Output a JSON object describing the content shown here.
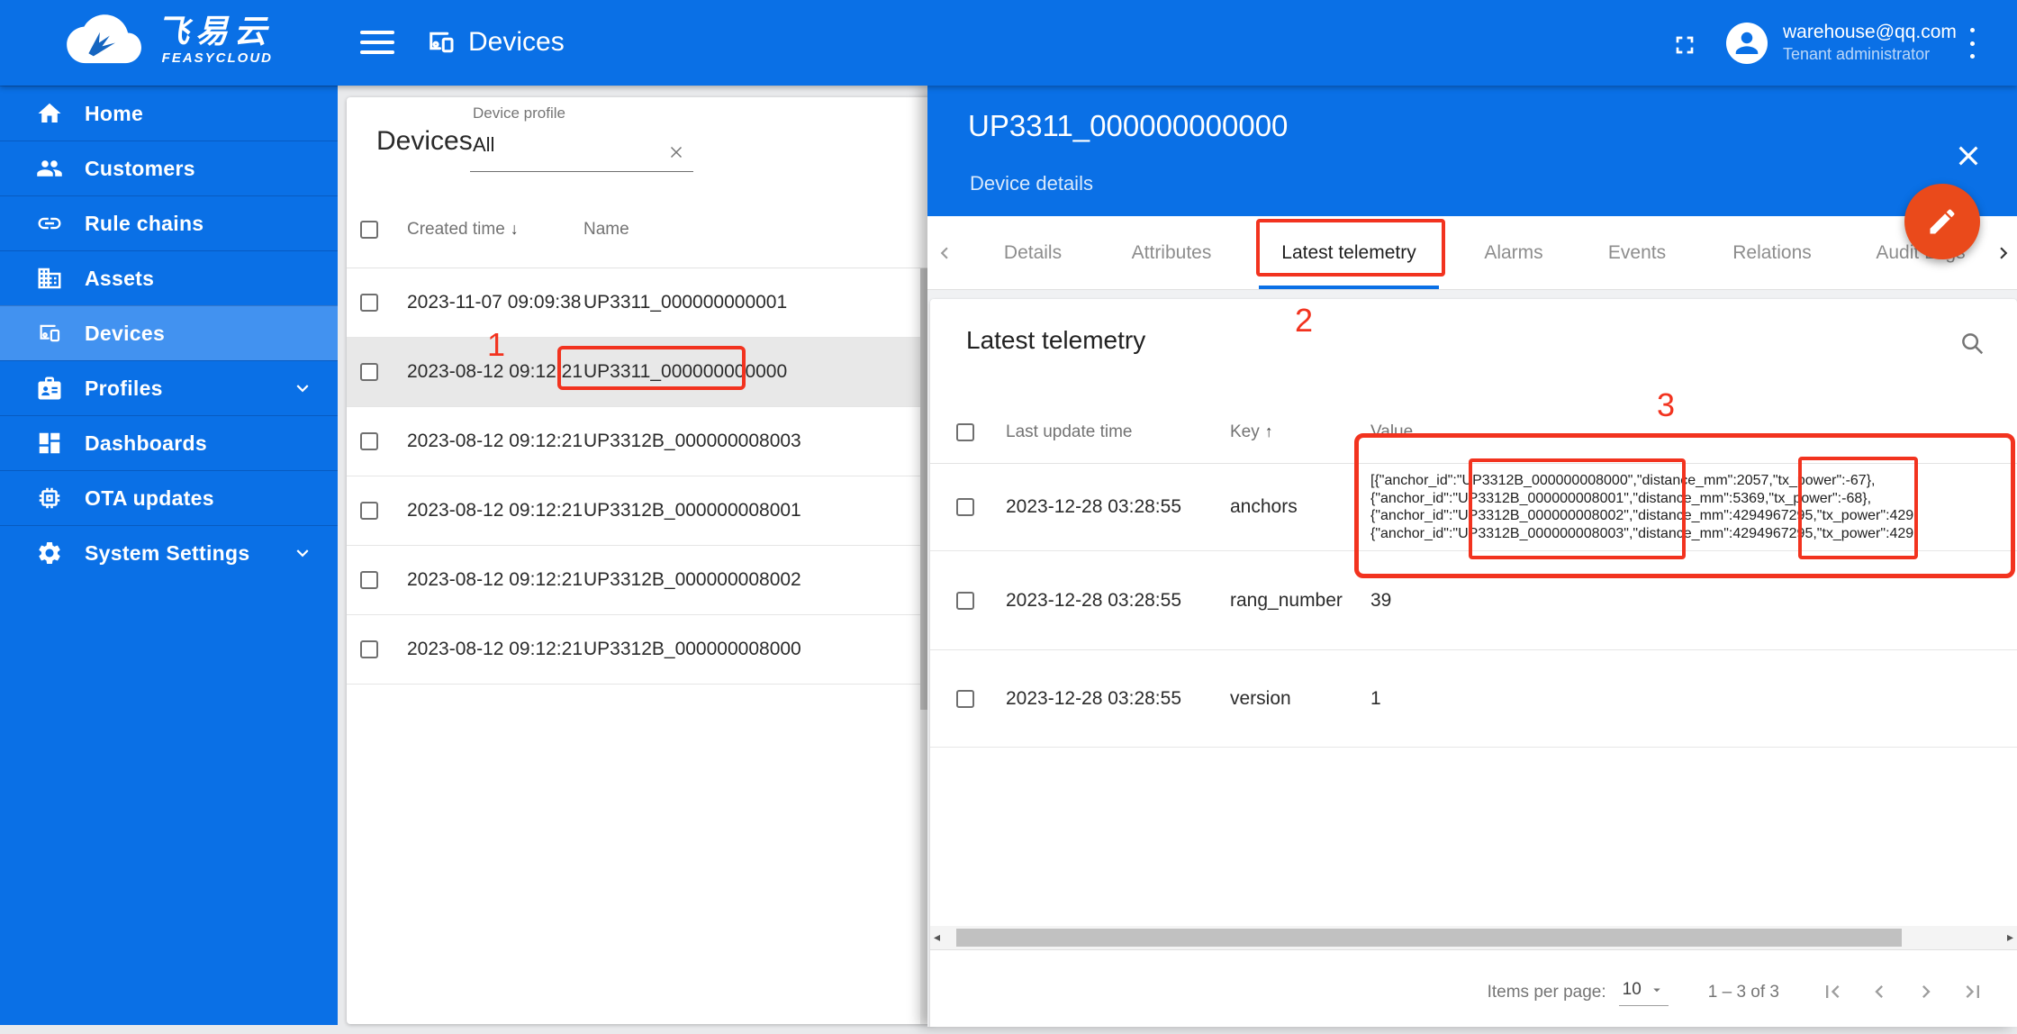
{
  "brand": {
    "name_cn": "飞易云",
    "name_en": "FEASYCLOUD"
  },
  "topbar": {
    "title": "Devices",
    "user_email": "warehouse@qq.com",
    "user_role": "Tenant administrator"
  },
  "sidebar": {
    "items": [
      {
        "label": "Home",
        "icon": "home-icon"
      },
      {
        "label": "Customers",
        "icon": "customers-icon"
      },
      {
        "label": "Rule chains",
        "icon": "rule-chains-icon"
      },
      {
        "label": "Assets",
        "icon": "assets-icon"
      },
      {
        "label": "Devices",
        "icon": "devices-icon",
        "selected": true
      },
      {
        "label": "Profiles",
        "icon": "profiles-icon",
        "expandable": true
      },
      {
        "label": "Dashboards",
        "icon": "dashboards-icon"
      },
      {
        "label": "OTA updates",
        "icon": "ota-updates-icon"
      },
      {
        "label": "System Settings",
        "icon": "system-settings-icon",
        "expandable": true
      }
    ]
  },
  "devices_panel": {
    "title": "Devices",
    "filter": {
      "label": "Device profile",
      "value": "All"
    },
    "columns": {
      "created_time": "Created time",
      "name": "Name"
    },
    "rows": [
      {
        "created_time": "2023-11-07 09:09:38",
        "name": "UP3311_000000000001"
      },
      {
        "created_time": "2023-08-12 09:12:21",
        "name": "UP3311_000000000000",
        "selected": true
      },
      {
        "created_time": "2023-08-12 09:12:21",
        "name": "UP3312B_000000008003"
      },
      {
        "created_time": "2023-08-12 09:12:21",
        "name": "UP3312B_000000008001"
      },
      {
        "created_time": "2023-08-12 09:12:21",
        "name": "UP3312B_000000008002"
      },
      {
        "created_time": "2023-08-12 09:12:21",
        "name": "UP3312B_000000008000"
      }
    ]
  },
  "details_panel": {
    "title": "UP3311_000000000000",
    "subtitle": "Device details",
    "tabs": [
      "Details",
      "Attributes",
      "Latest telemetry",
      "Alarms",
      "Events",
      "Relations",
      "Audit Logs"
    ],
    "active_tab": "Latest telemetry",
    "section_title": "Latest telemetry",
    "table": {
      "columns": {
        "time": "Last update time",
        "key": "Key",
        "value": "Value"
      },
      "rows": [
        {
          "time": "2023-12-28 03:28:55",
          "key": "anchors",
          "value_lines": [
            "[{\"anchor_id\":\"UP3312B_000000008000\",\"distance_mm\":2057,\"tx_power\":-67},",
            "{\"anchor_id\":\"UP3312B_000000008001\",\"distance_mm\":5369,\"tx_power\":-68},",
            "{\"anchor_id\":\"UP3312B_000000008002\",\"distance_mm\":4294967295,\"tx_power\":429",
            "{\"anchor_id\":\"UP3312B_000000008003\",\"distance_mm\":4294967295,\"tx_power\":429"
          ]
        },
        {
          "time": "2023-12-28 03:28:55",
          "key": "rang_number",
          "value": "39"
        },
        {
          "time": "2023-12-28 03:28:55",
          "key": "version",
          "value": "1"
        }
      ]
    },
    "pagination": {
      "items_per_page_label": "Items per page:",
      "items_per_page": "10",
      "range_label": "1 – 3 of 3"
    }
  },
  "annotations": {
    "step1": "1",
    "step2": "2",
    "step3": "3"
  },
  "colors": {
    "primary": "#0a70e6",
    "primary_light": "#4292f0",
    "annotation_red": "#f2331f",
    "fab_orange": "#ea4a1b",
    "tab_underline": "#0a70e6"
  }
}
